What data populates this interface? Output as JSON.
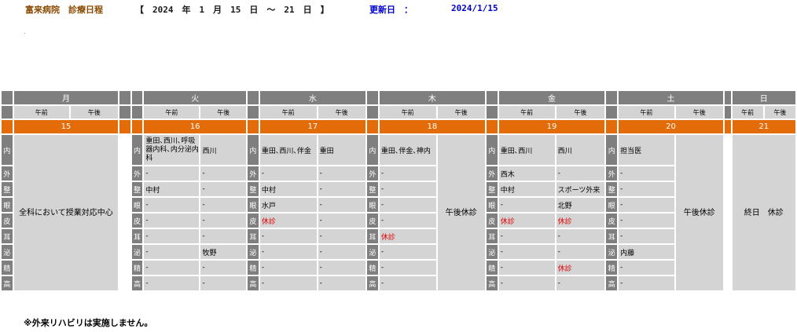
{
  "header": {
    "hospital": "富来病院　診療日程",
    "week_range": "【　2024　年　1　月　15　日　～　21　日　】",
    "updated_label": "更新日　：",
    "updated_date": "2024/1/15"
  },
  "ampm": {
    "am": "午前",
    "pm": "午後"
  },
  "days": [
    {
      "name": "月",
      "date": "15"
    },
    {
      "name": "火",
      "date": "16"
    },
    {
      "name": "水",
      "date": "17"
    },
    {
      "name": "木",
      "date": "18"
    },
    {
      "name": "金",
      "date": "19"
    },
    {
      "name": "土",
      "date": "20"
    },
    {
      "name": "日",
      "date": "21"
    }
  ],
  "departments": [
    "内",
    "外",
    "整",
    "眼",
    "皮",
    "耳",
    "泌",
    "精",
    "高"
  ],
  "merged": {
    "monday": "全科において授業対応中心",
    "thursday_pm": "午後休診",
    "saturday_pm": "午後休診",
    "sunday": "終日　休診"
  },
  "schedule": {
    "tue": [
      [
        "重田､西川､呼吸器内科､内分泌内科",
        "西川"
      ],
      [
        "-",
        "-"
      ],
      [
        "中村",
        "-"
      ],
      [
        "-",
        "-"
      ],
      [
        "-",
        "-"
      ],
      [
        "-",
        "-"
      ],
      [
        "-",
        "牧野"
      ],
      [
        "-",
        "-"
      ],
      [
        "-",
        "-"
      ]
    ],
    "wed": [
      [
        "重田､西川､伴金",
        "重田"
      ],
      [
        "-",
        "-"
      ],
      [
        "中村",
        "-"
      ],
      [
        "水戸",
        "-"
      ],
      [
        "休診",
        "-"
      ],
      [
        "-",
        "-"
      ],
      [
        "-",
        "-"
      ],
      [
        "-",
        "-"
      ],
      [
        "-",
        "-"
      ]
    ],
    "thu": [
      "重田､伴金､神内",
      "-",
      "-",
      "-",
      "-",
      "休診",
      "-",
      "-",
      "-"
    ],
    "fri": [
      [
        "重田､西川",
        "西川"
      ],
      [
        "西木",
        "-"
      ],
      [
        "中村",
        "スポーツ外来"
      ],
      [
        "-",
        "北野"
      ],
      [
        "休診",
        "休診"
      ],
      [
        "-",
        "-"
      ],
      [
        "-",
        "-"
      ],
      [
        "-",
        "休診"
      ],
      [
        "-",
        "-"
      ]
    ],
    "sat": [
      "担当医",
      "-",
      "-",
      "-",
      "-",
      "-",
      "内藤",
      "-",
      "-"
    ]
  },
  "footer": {
    "note": "※外来リハビリは実施しません。"
  },
  "colors": {
    "header_gray": "#7f7f7f",
    "date_orange": "#e36c09",
    "cell_gray": "#d4d4d4",
    "closed_red": "#e00000"
  }
}
